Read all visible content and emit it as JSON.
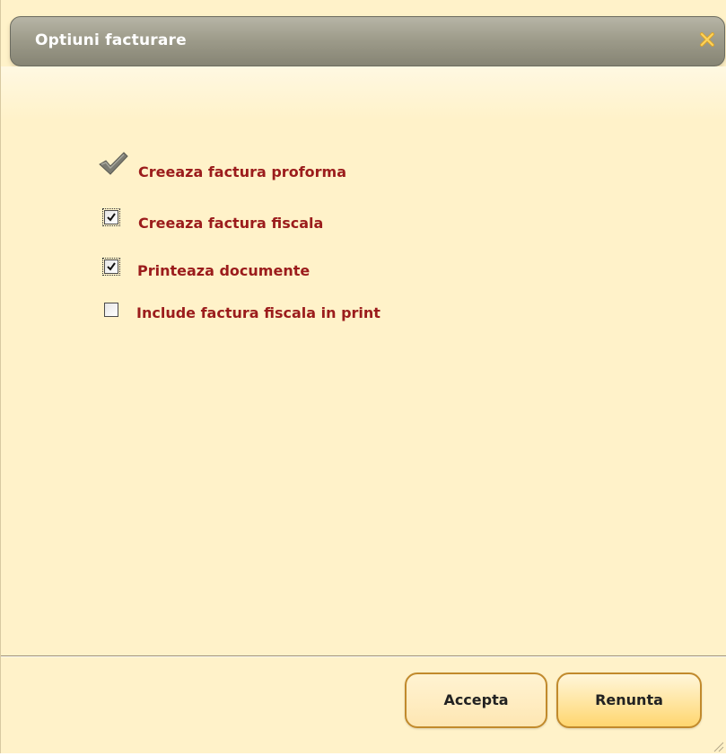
{
  "window": {
    "title": "Optiuni facturare",
    "close_icon": "close-icon",
    "accent": "#9b1c1c",
    "background": "#fff2c9"
  },
  "options": [
    {
      "label": "Creeaza factura proforma",
      "state": "checked-locked",
      "icon": "checkmark-icon"
    },
    {
      "label": "Creeaza factura fiscala",
      "state": "checked"
    },
    {
      "label": "Printeaza documente",
      "state": "checked"
    },
    {
      "label": "Include factura fiscala in print",
      "state": "unchecked"
    }
  ],
  "footer": {
    "accept_label": "Accepta",
    "cancel_label": "Renunta"
  }
}
